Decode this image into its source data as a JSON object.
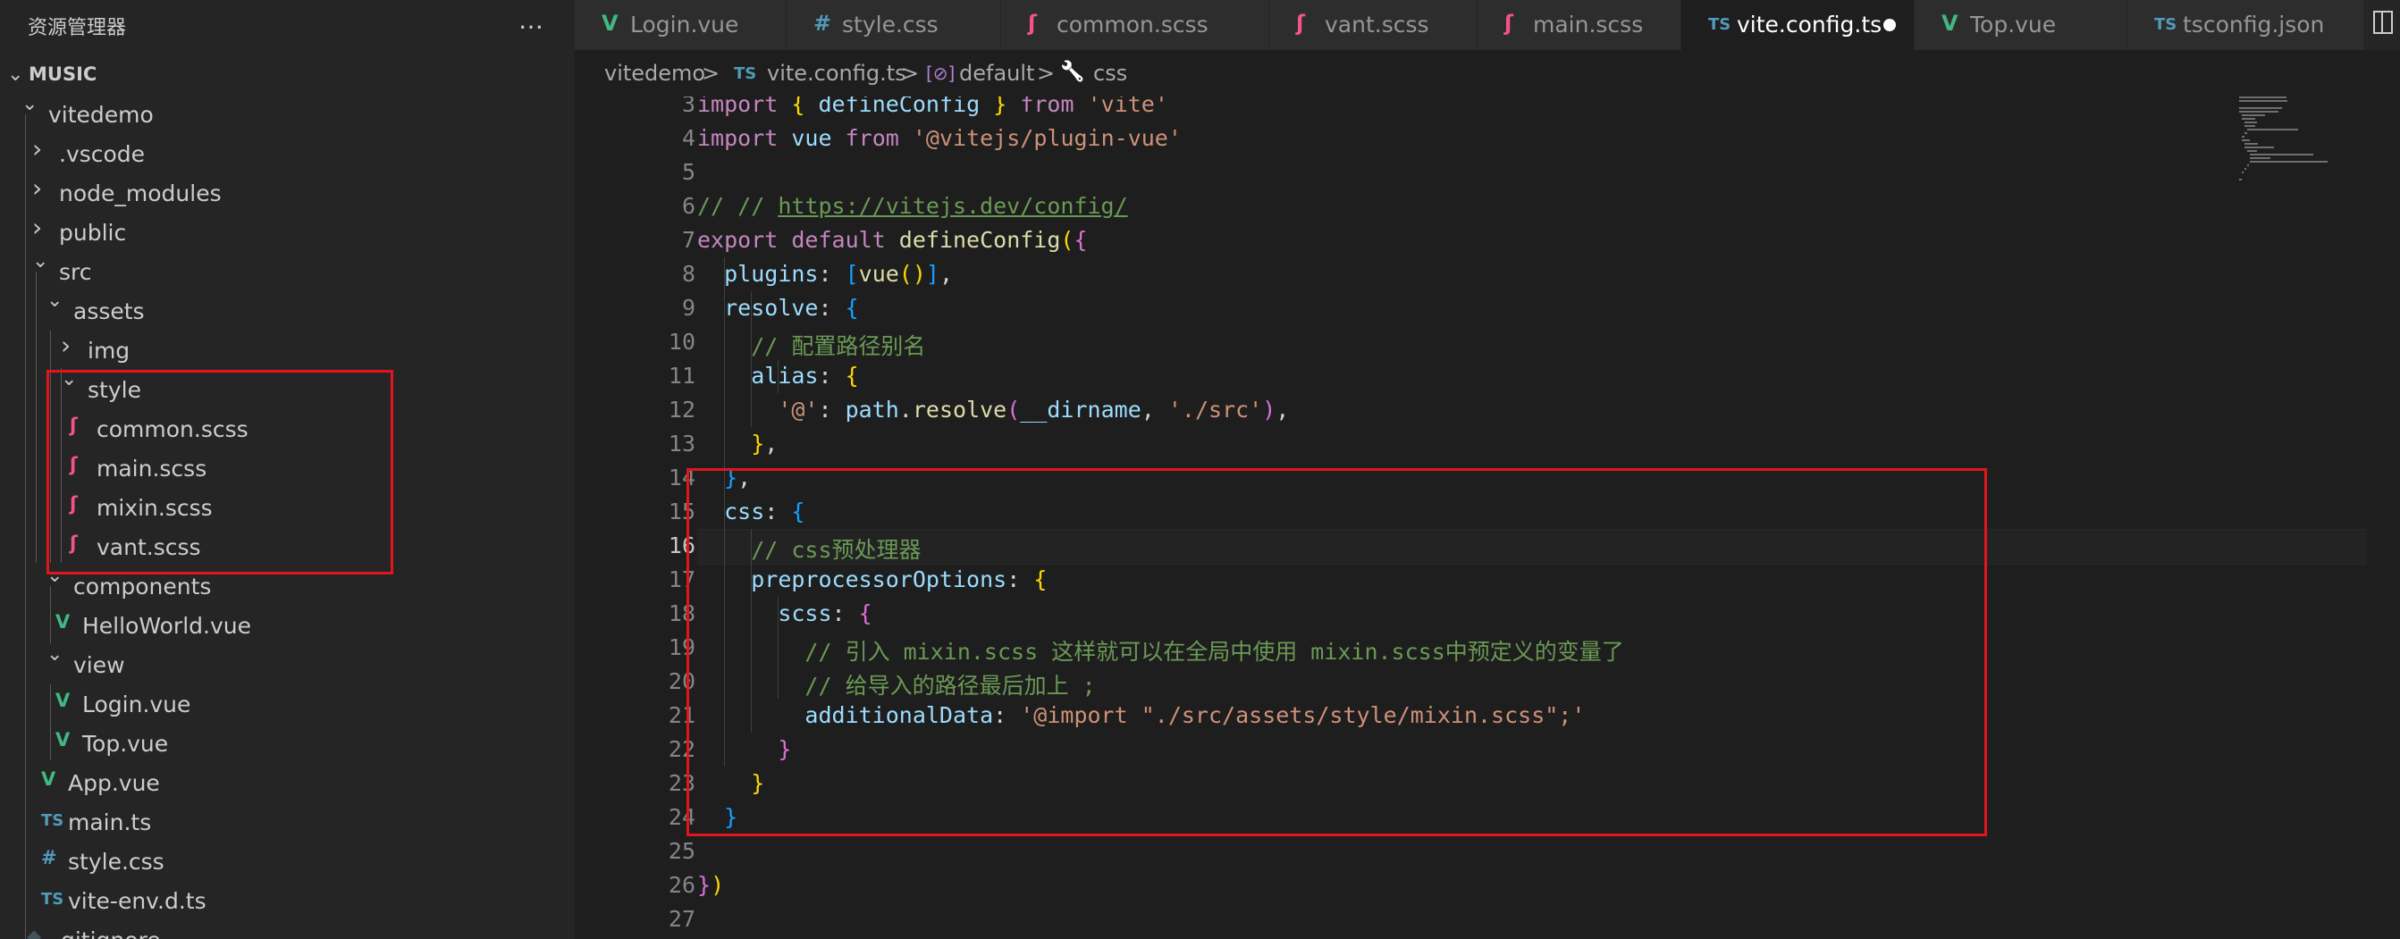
{
  "sidebar": {
    "title": "资源管理器",
    "more_icon": "…",
    "root_label": "MUSIC",
    "tree": [
      {
        "label": "vitedemo",
        "type": "folder",
        "expanded": true,
        "depth": 1
      },
      {
        "label": ".vscode",
        "type": "folder",
        "expanded": false,
        "depth": 2
      },
      {
        "label": "node_modules",
        "type": "folder",
        "expanded": false,
        "depth": 2
      },
      {
        "label": "public",
        "type": "folder",
        "expanded": false,
        "depth": 2
      },
      {
        "label": "src",
        "type": "folder",
        "expanded": true,
        "depth": 2
      },
      {
        "label": "assets",
        "type": "folder",
        "expanded": true,
        "depth": 3
      },
      {
        "label": "img",
        "type": "folder",
        "expanded": false,
        "depth": 4
      },
      {
        "label": "style",
        "type": "folder",
        "expanded": true,
        "depth": 4
      },
      {
        "label": "common.scss",
        "type": "scss",
        "depth": 5
      },
      {
        "label": "main.scss",
        "type": "scss",
        "depth": 5
      },
      {
        "label": "mixin.scss",
        "type": "scss",
        "depth": 5
      },
      {
        "label": "vant.scss",
        "type": "scss",
        "depth": 5
      },
      {
        "label": "components",
        "type": "folder",
        "expanded": true,
        "depth": 3
      },
      {
        "label": "HelloWorld.vue",
        "type": "vue",
        "depth": 4
      },
      {
        "label": "view",
        "type": "folder",
        "expanded": true,
        "depth": 3
      },
      {
        "label": "Login.vue",
        "type": "vue",
        "depth": 4
      },
      {
        "label": "Top.vue",
        "type": "vue",
        "depth": 4
      },
      {
        "label": "App.vue",
        "type": "vue",
        "depth": 3
      },
      {
        "label": "main.ts",
        "type": "ts",
        "depth": 3
      },
      {
        "label": "style.css",
        "type": "css",
        "depth": 3
      },
      {
        "label": "vite-env.d.ts",
        "type": "ts",
        "depth": 3
      },
      {
        "label": ".gitignore",
        "type": "git",
        "depth": 2
      }
    ]
  },
  "tabs": [
    {
      "label": "Login.vue",
      "type": "vue",
      "active": false
    },
    {
      "label": "style.css",
      "type": "css",
      "active": false
    },
    {
      "label": "common.scss",
      "type": "scss",
      "active": false
    },
    {
      "label": "vant.scss",
      "type": "scss",
      "active": false
    },
    {
      "label": "main.scss",
      "type": "scss",
      "active": false
    },
    {
      "label": "vite.config.ts",
      "type": "ts",
      "active": true,
      "modified": true
    },
    {
      "label": "Top.vue",
      "type": "vue",
      "active": false
    },
    {
      "label": "tsconfig.json",
      "type": "ts",
      "active": false
    }
  ],
  "file_icons": {
    "vue": "V",
    "css": "#",
    "ts": "TS",
    "scss": "ʃ",
    "git": "◆"
  },
  "breadcrumb": {
    "folder": "vitedemo",
    "file_icon": "TS",
    "file": "vite.config.ts",
    "symbol_icon": "[⊘]",
    "symbol": "default",
    "prop_icon": "🔧",
    "prop": "css",
    "sep": ">"
  },
  "editor": {
    "current_line": 16,
    "lines": [
      {
        "n": 3,
        "text": "import { defineConfig } from 'vite'"
      },
      {
        "n": 4,
        "text": "import vue from '@vitejs/plugin-vue'"
      },
      {
        "n": 5,
        "text": ""
      },
      {
        "n": 6,
        "text": "// // https://vitejs.dev/config/"
      },
      {
        "n": 7,
        "text": "export default defineConfig({"
      },
      {
        "n": 8,
        "text": "  plugins: [vue()],"
      },
      {
        "n": 9,
        "text": "  resolve: {"
      },
      {
        "n": 10,
        "text": "    // 配置路径别名"
      },
      {
        "n": 11,
        "text": "    alias: {"
      },
      {
        "n": 12,
        "text": "      '@': path.resolve(__dirname, './src'),"
      },
      {
        "n": 13,
        "text": "    },"
      },
      {
        "n": 14,
        "text": "  },"
      },
      {
        "n": 15,
        "text": "  css: {"
      },
      {
        "n": 16,
        "text": "    // css预处理器"
      },
      {
        "n": 17,
        "text": "    preprocessorOptions: {"
      },
      {
        "n": 18,
        "text": "      scss: {"
      },
      {
        "n": 19,
        "text": "        // 引入 mixin.scss 这样就可以在全局中使用 mixin.scss中预定义的变量了"
      },
      {
        "n": 20,
        "text": "        // 给导入的路径最后加上 ;"
      },
      {
        "n": 21,
        "text": "        additionalData: '@import \"./src/assets/style/mixin.scss\";'"
      },
      {
        "n": 22,
        "text": "      }"
      },
      {
        "n": 23,
        "text": "    }"
      },
      {
        "n": 24,
        "text": "  }"
      },
      {
        "n": 25,
        "text": ""
      },
      {
        "n": 26,
        "text": "})"
      },
      {
        "n": 27,
        "text": ""
      }
    ]
  },
  "colors": {
    "highlight_box": "#e0161a",
    "vue_icon": "#41b883",
    "ts_icon": "#519aba",
    "scss_icon": "#f55385"
  }
}
